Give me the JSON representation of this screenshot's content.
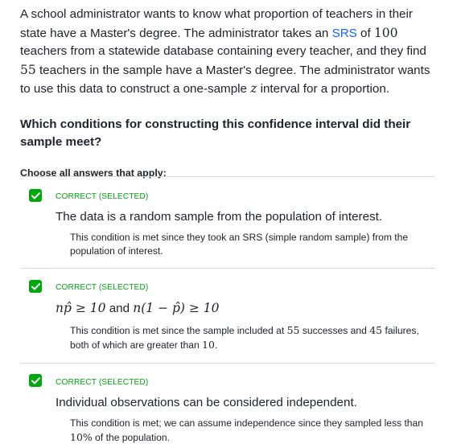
{
  "question_stem": {
    "part1": "A school administrator wants to know what proportion of teachers in their state have a Master's degree. The administrator takes an ",
    "srs_link": "SRS",
    "part2": " of ",
    "sample_size": "100",
    "part3": " teachers from a statewide database containing every teacher, and they find ",
    "count": "55",
    "part4": " teachers in the sample have a Master's degree. The administrator wants to use this data to construct a one-sample ",
    "z_var": "z",
    "part5": " interval for a proportion."
  },
  "question": "Which conditions for constructing this confidence interval did their sample meet?",
  "instructions": "Choose all answers that apply:",
  "choices": [
    {
      "status": "CORRECT (SELECTED)",
      "statement": "The data is a random sample from the population of interest.",
      "rationale": "This condition is met since they took an SRS (simple random sample) from the population of interest."
    },
    {
      "status": "CORRECT (SELECTED)",
      "statement_math_left": "np̂ ≥ 10",
      "statement_and": " and ",
      "statement_math_right": "n(1 − p̂) ≥ 10",
      "rationale_part1": "This condition is met since the sample included at ",
      "successes": "55",
      "rationale_part2": " successes and ",
      "failures": "45",
      "rationale_part3": " failures, both of which are greater than ",
      "threshold": "10",
      "rationale_part4": "."
    },
    {
      "status": "CORRECT (SELECTED)",
      "statement": "Individual observations can be considered independent.",
      "rationale_part1": "This condition is met; we can assume independence since they sampled less than ",
      "percent": "10%",
      "rationale_part2": " of the population."
    }
  ],
  "colors": {
    "correct_green": "#00a60e",
    "link_blue": "#1865f2",
    "text": "#21242c",
    "divider": "#d6d8da"
  }
}
